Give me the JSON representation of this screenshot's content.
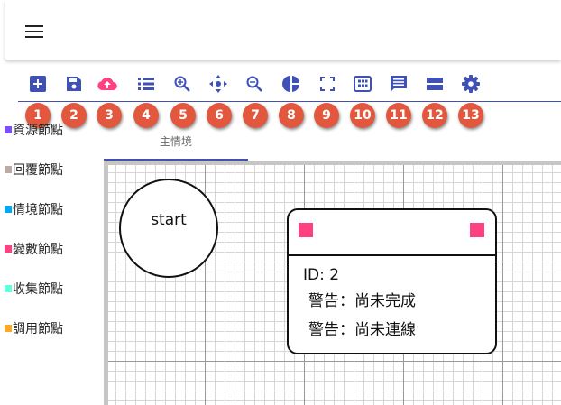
{
  "toolbar": {
    "tools": [
      {
        "icon": "add-box-icon",
        "badge": "1"
      },
      {
        "icon": "save-icon",
        "badge": "2"
      },
      {
        "icon": "cloud-upload-icon",
        "badge": "3"
      },
      {
        "icon": "list-icon",
        "badge": "4"
      },
      {
        "icon": "zoom-in-icon",
        "badge": "5"
      },
      {
        "icon": "move-icon",
        "badge": "6"
      },
      {
        "icon": "zoom-out-icon",
        "badge": "7"
      },
      {
        "icon": "pie-chart-icon",
        "badge": "8"
      },
      {
        "icon": "fullscreen-icon",
        "badge": "9"
      },
      {
        "icon": "view-module-icon",
        "badge": "10"
      },
      {
        "icon": "comment-icon",
        "badge": "11"
      },
      {
        "icon": "view-stream-icon",
        "badge": "12"
      },
      {
        "icon": "settings-icon",
        "badge": "13"
      }
    ],
    "accent": "#3f51b5",
    "badge_color": "#e2583e"
  },
  "palette": {
    "items": [
      {
        "label": "資源節點",
        "color": "#7c4dff"
      },
      {
        "label": "回覆節點",
        "color": "#bcaaa4"
      },
      {
        "label": "情境節點",
        "color": "#03a9f4"
      },
      {
        "label": "變數節點",
        "color": "#ff4081"
      },
      {
        "label": "收集節點",
        "color": "#64ffda"
      },
      {
        "label": "調用節點",
        "color": "#ffa726"
      }
    ]
  },
  "tabs": {
    "active": "主情境"
  },
  "canvas": {
    "start_node": {
      "label": "start"
    },
    "variable_node": {
      "id_text": "ID: 2",
      "warning_1": "警告：尚未完成",
      "warning_2": "警告：尚未連線",
      "port_color": "#ff4081"
    }
  }
}
